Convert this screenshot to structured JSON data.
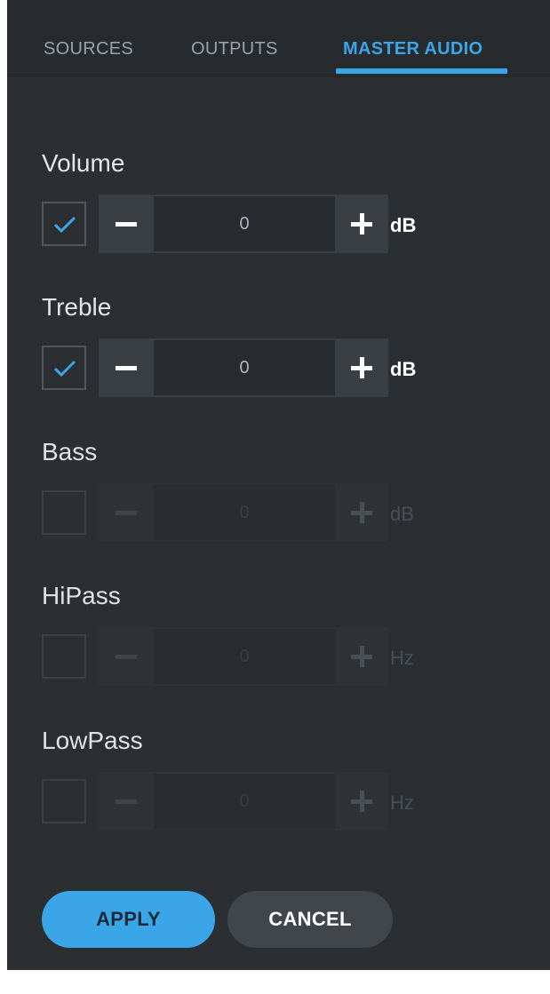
{
  "tabs": [
    {
      "label": "SOURCES",
      "active": false
    },
    {
      "label": "OUTPUTS",
      "active": false
    },
    {
      "label": "MASTER AUDIO",
      "active": true
    }
  ],
  "controls": [
    {
      "label": "Volume",
      "checked": true,
      "value": "0",
      "unit": "dB",
      "enabled": true
    },
    {
      "label": "Treble",
      "checked": true,
      "value": "0",
      "unit": "dB",
      "enabled": true
    },
    {
      "label": "Bass",
      "checked": false,
      "value": "0",
      "unit": "dB",
      "enabled": false
    },
    {
      "label": "HiPass",
      "checked": false,
      "value": "0",
      "unit": "Hz",
      "enabled": false
    },
    {
      "label": "LowPass",
      "checked": false,
      "value": "0",
      "unit": "Hz",
      "enabled": false
    }
  ],
  "buttons": {
    "apply": "APPLY",
    "cancel": "CANCEL"
  },
  "colors": {
    "accent": "#3aa6e8",
    "panel_bg": "#2b2f32",
    "tabbar_bg": "#282b2e"
  }
}
